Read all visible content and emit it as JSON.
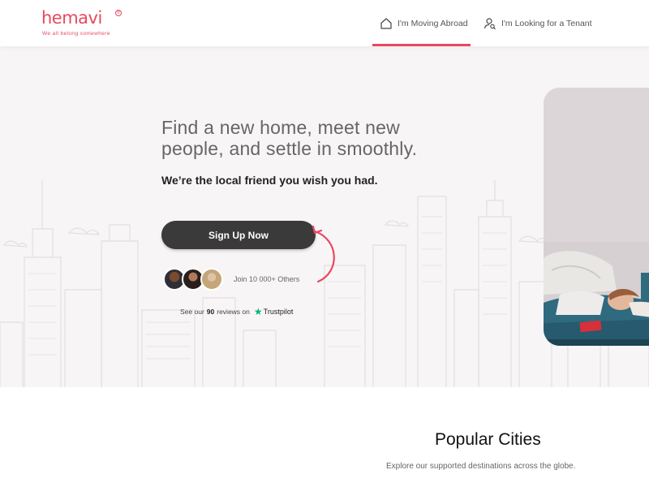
{
  "brand": {
    "name": "hemavi",
    "reg_mark": "®",
    "tagline": "We all belong somewhere",
    "color": "#e8485f"
  },
  "nav": {
    "items": [
      {
        "label": "I'm Moving Abroad",
        "icon": "house-icon",
        "active": true
      },
      {
        "label": "I'm Looking for a Tenant",
        "icon": "user-search-icon",
        "active": false
      }
    ]
  },
  "hero": {
    "headline_line1": "Find a new home, meet new",
    "headline_line2": "people, and settle in smoothly.",
    "subheadline": "We’re the local friend you wish you had.",
    "cta_label": "Sign Up Now",
    "join_text": "Join 10 000+ Others",
    "reviews_prefix": "See our",
    "reviews_count": "90",
    "reviews_suffix": "reviews on",
    "trustpilot_label": "Trustpilot",
    "trustpilot_color": "#00b67a"
  },
  "cities": {
    "title": "Popular Cities",
    "subtitle": "Explore our supported destinations across the globe."
  }
}
